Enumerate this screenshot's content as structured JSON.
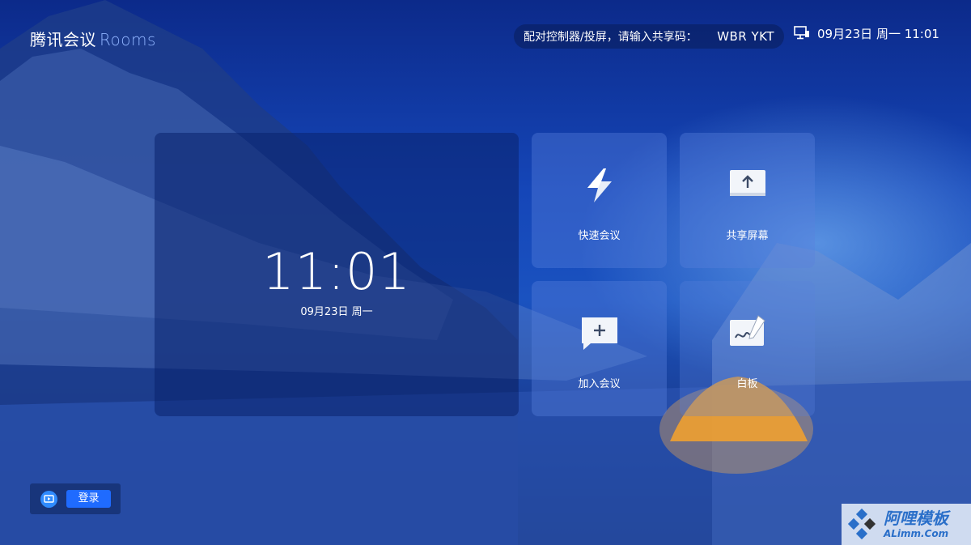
{
  "header": {
    "brand_name": "腾讯会议",
    "brand_suffix": "Rooms",
    "pair_prompt": "配对控制器/投屏，请输入共享码：",
    "share_code": "WBR YKT",
    "status_datetime": "09月23日 周一 11:01",
    "status_icon": "screen-network-icon"
  },
  "clock": {
    "time": "11:01",
    "date": "09月23日 周一"
  },
  "tiles": [
    {
      "label": "快速会议",
      "icon": "lightning-icon"
    },
    {
      "label": "共享屏幕",
      "icon": "share-screen-icon"
    },
    {
      "label": "加入会议",
      "icon": "add-chat-icon"
    },
    {
      "label": "白板",
      "icon": "whiteboard-icon"
    }
  ],
  "login": {
    "label": "登录",
    "icon": "tv-icon"
  },
  "watermark": {
    "cn": "阿哩模板",
    "en": "ALimm.Com"
  },
  "colors": {
    "accent": "#1f6bff",
    "brand_suffix": "#8fb4ff"
  }
}
